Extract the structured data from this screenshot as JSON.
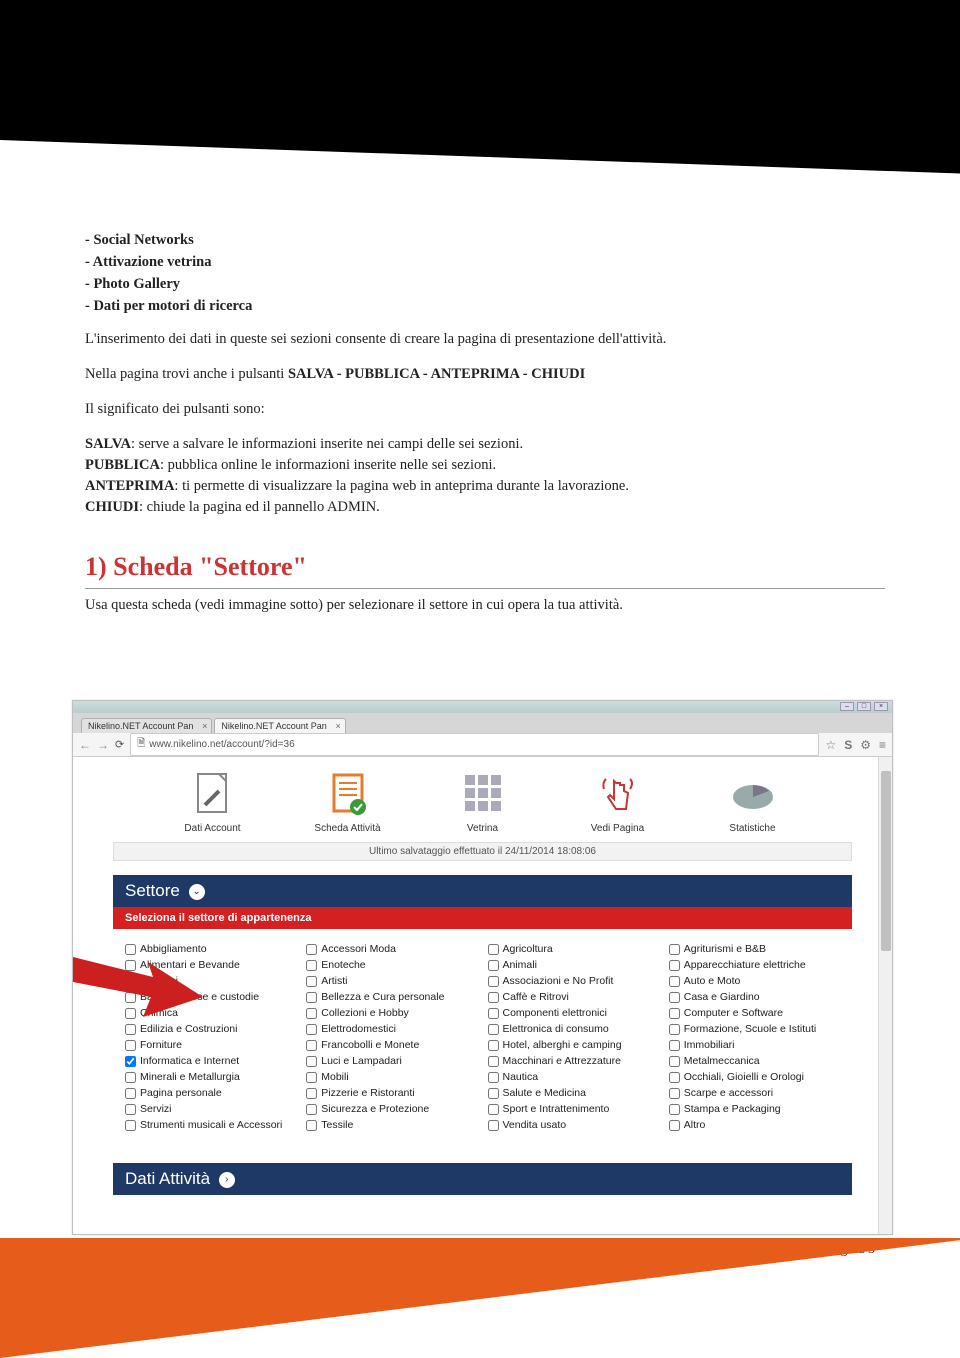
{
  "bullets": {
    "b1": "- Social Networks",
    "b2": "- Attivazione vetrina",
    "b3": "- Photo Gallery",
    "b4": "- Dati per motori di ricerca"
  },
  "para1": "L'inserimento dei dati in queste sei sezioni consente di creare la pagina di presentazione dell'attività.",
  "para2_pre": "Nella pagina trovi anche i pulsanti ",
  "para2_bold": "SALVA - PUBBLICA - ANTEPRIMA - CHIUDI",
  "para3": "Il significato dei pulsanti sono:",
  "defs": {
    "salva_k": "SALVA",
    "salva_v": ": serve a salvare le informazioni inserite nei campi delle sei sezioni.",
    "pubblica_k": "PUBBLICA",
    "pubblica_v": ": pubblica online le informazioni inserite nelle sei sezioni.",
    "anteprima_k": "ANTEPRIMA",
    "anteprima_v": ": ti permette di visualizzare la pagina web in anteprima durante la lavorazione.",
    "chiudi_k": "CHIUDI",
    "chiudi_v": ": chiude la pagina ed il pannello ADMIN."
  },
  "section_title": "1) Scheda \"Settore\"",
  "section_sub": "Usa questa scheda (vedi immagine sotto) per selezionare il settore in cui opera la tua attività.",
  "browser": {
    "tab1": "Nikelino.NET Account Pan",
    "tab2": "Nikelino.NET Account Pan",
    "url": "www.nikelino.net/account/?id=36"
  },
  "nav": {
    "n1": "Dati Account",
    "n2": "Scheda Attività",
    "n3": "Vetrina",
    "n4": "Vedi Pagina",
    "n5": "Statistiche"
  },
  "savebar": "Ultimo salvataggio effettuato il 24/11/2014 18:08:06",
  "settore_title": "Settore",
  "settore_sub": "Seleziona il settore di appartenenza",
  "sectors": [
    "Abbigliamento",
    "Accessori Moda",
    "Agricoltura",
    "Agriturismi e B&B",
    "Alimentari e Bevande",
    "Enoteche",
    "Animali",
    "Apparecchiature elettriche",
    "Artigiani",
    "Artisti",
    "Associazioni e No Profit",
    "Auto e Moto",
    "Bagagli, Borse e custodie",
    "Bellezza e Cura personale",
    "Caffè e Ritrovi",
    "Casa e Giardino",
    "Chimica",
    "Collezioni e Hobby",
    "Componenti elettronici",
    "Computer e Software",
    "Edilizia e Costruzioni",
    "Elettrodomestici",
    "Elettronica di consumo",
    "Formazione, Scuole e Istituti",
    "Forniture",
    "Francobolli e Monete",
    "Hotel, alberghi e camping",
    "Immobiliari",
    "Informatica e Internet",
    "Luci e Lampadari",
    "Macchinari e Attrezzature",
    "Metalmeccanica",
    "Minerali e Metallurgia",
    "Mobili",
    "Nautica",
    "Occhiali, Gioielli e Orologi",
    "Pagina personale",
    "Pizzerie e Ristoranti",
    "Salute e Medicina",
    "Scarpe e accessori",
    "Servizi",
    "Sicurezza e Protezione",
    "Sport e Intrattenimento",
    "Stampa e Packaging",
    "Strumenti musicali e Accessori",
    "Tessile",
    "Vendita usato",
    "Altro"
  ],
  "checked_sector": "Informatica e Internet",
  "dati_title": "Dati Attività",
  "page_num": "Pagina 3"
}
